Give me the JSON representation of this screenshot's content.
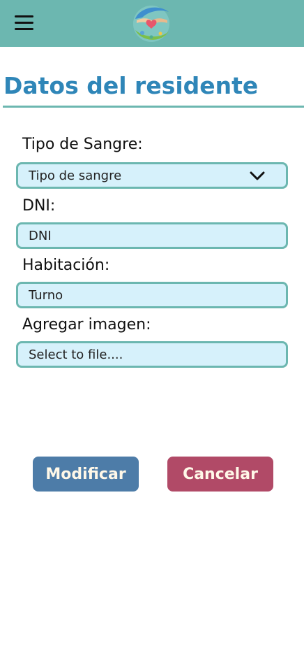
{
  "header": {
    "menu_icon": "hamburger-menu-icon",
    "logo_icon": "hands-heart-logo",
    "colors": {
      "bar": "#6cb7b0"
    }
  },
  "page": {
    "title": "Datos del residente",
    "title_color": "#2f86b8"
  },
  "form": {
    "blood_type": {
      "label": "Tipo de Sangre:",
      "selected_value": "Tipo de sangre",
      "icon": "chevron-down-icon"
    },
    "dni": {
      "label": "DNI:",
      "placeholder": "DNI"
    },
    "room": {
      "label": "Habitación:",
      "placeholder": "Turno"
    },
    "image": {
      "label": "Agregar imagen:",
      "placeholder": "Select to file...."
    }
  },
  "actions": {
    "modify_label": "Modificar",
    "cancel_label": "Cancelar",
    "colors": {
      "modify": "#4d7ca8",
      "cancel": "#b14a67"
    }
  }
}
